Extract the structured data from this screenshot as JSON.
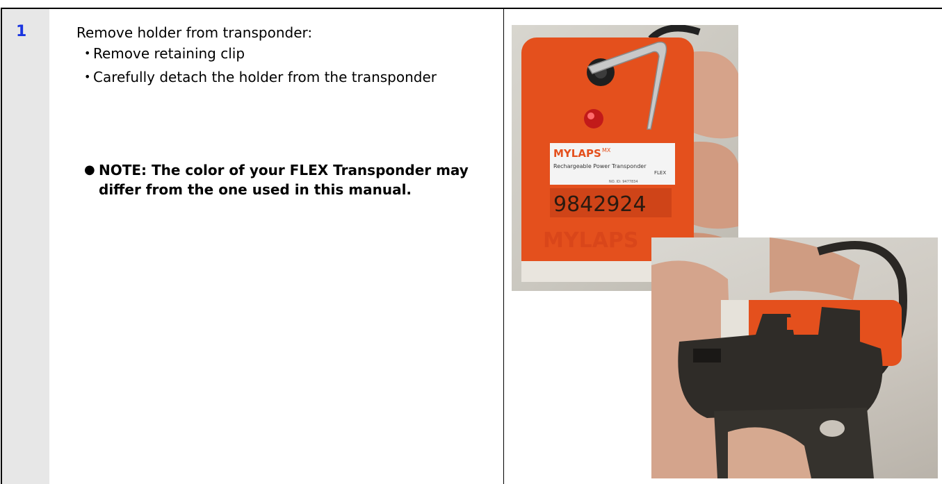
{
  "step": {
    "number": "1",
    "instruction": "Remove holder from transponder:",
    "bullets": [
      "Remove retaining clip",
      "Carefully detach the holder from the transponder"
    ],
    "note": "NOTE: The color of your FLEX Transponder may differ from the one used in this manual."
  },
  "photo_transponder": {
    "brand": "MYLAPS",
    "brand_suffix": "MX",
    "product_line": "Rechargeable Power Transponder",
    "variant": "FLEX",
    "serial_small": "NO. ID: 9477834",
    "transponder_id": "9842924",
    "body_color": "#e4501d"
  },
  "photo_holder": {
    "holder_color": "#2f2c28",
    "body_color": "#e4501d"
  }
}
